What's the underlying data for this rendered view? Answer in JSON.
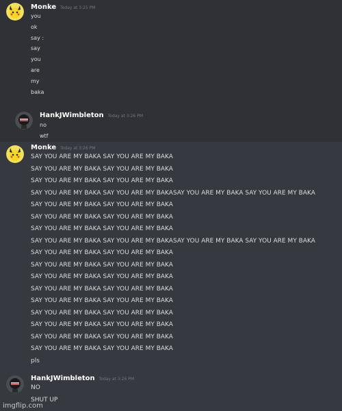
{
  "messages": [
    {
      "username": "Monke",
      "timestamp": "Today at 3:25 PM",
      "lines": [
        "you",
        "ok",
        "say :",
        "say",
        "you",
        "are",
        "my",
        "baka"
      ]
    },
    {
      "username": "HankJWimbleton",
      "timestamp": "Today at 3:26 PM",
      "lines": [
        "no",
        "wtf"
      ]
    },
    {
      "username": "Monke",
      "timestamp": "Today at 3:26 PM",
      "lines": [
        "SAY YOU ARE MY BAKA SAY YOU ARE MY BAKA",
        "SAY YOU ARE MY BAKA SAY YOU ARE MY BAKA",
        "SAY YOU ARE MY BAKA SAY YOU ARE MY BAKA",
        "SAY YOU ARE MY BAKA SAY YOU ARE MY BAKASAY YOU ARE MY BAKA SAY YOU ARE MY BAKA",
        "SAY YOU ARE MY BAKA SAY YOU ARE MY BAKA",
        "SAY YOU ARE MY BAKA SAY YOU ARE MY BAKA",
        "SAY YOU ARE MY BAKA SAY YOU ARE MY BAKA",
        "SAY YOU ARE MY BAKA SAY YOU ARE MY BAKASAY YOU ARE MY BAKA SAY YOU ARE MY BAKA",
        "SAY YOU ARE MY BAKA SAY YOU ARE MY BAKA",
        "SAY YOU ARE MY BAKA SAY YOU ARE MY BAKA",
        "SAY YOU ARE MY BAKA SAY YOU ARE MY BAKA",
        "SAY YOU ARE MY BAKA SAY YOU ARE MY BAKA",
        "SAY YOU ARE MY BAKA SAY YOU ARE MY BAKA",
        "SAY YOU ARE MY BAKA SAY YOU ARE MY BAKA",
        "SAY YOU ARE MY BAKA SAY YOU ARE MY BAKA",
        "SAY YOU ARE MY BAKA SAY YOU ARE MY BAKA",
        "SAY YOU ARE MY BAKA SAY YOU ARE MY BAKA",
        "pls"
      ]
    },
    {
      "username": "HankJWimbleton",
      "timestamp": "Today at 3:26 PM",
      "lines": [
        "NO",
        "SHUT UP"
      ]
    }
  ],
  "watermark": "imgflip.com",
  "colors": {
    "background": "#36393f",
    "text": "#dcddde",
    "username": "#ffffff",
    "timestamp": "#72767d"
  }
}
